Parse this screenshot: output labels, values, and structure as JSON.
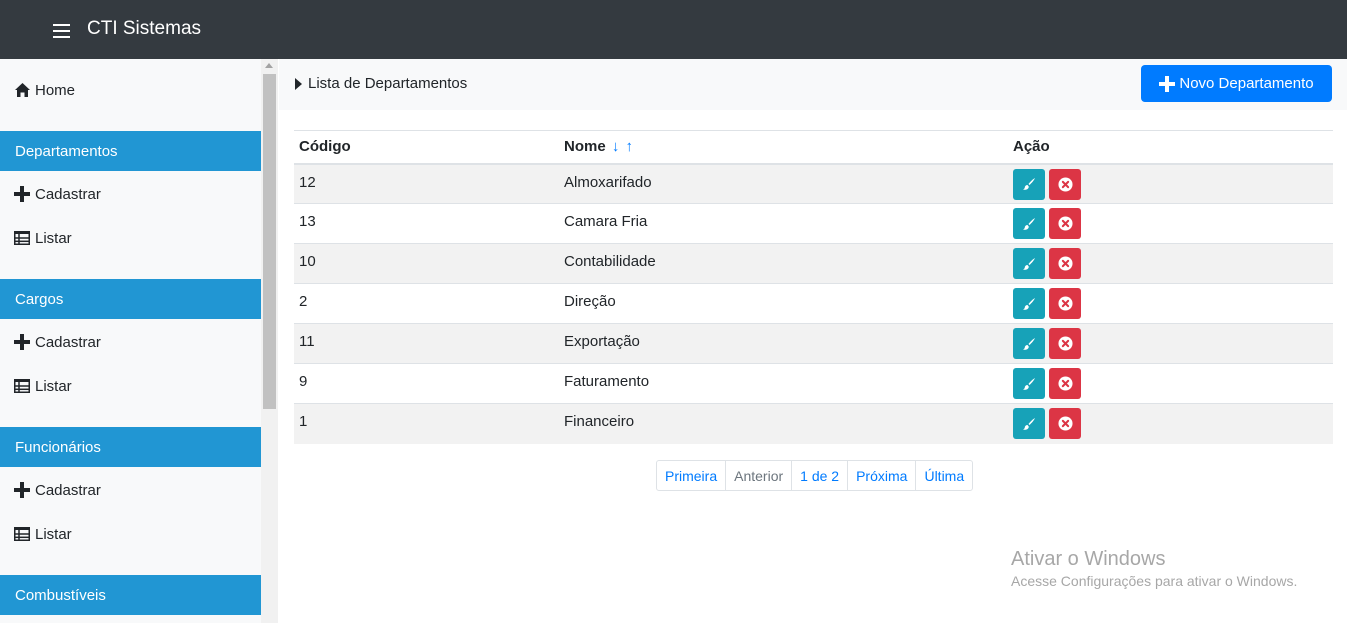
{
  "navbar": {
    "brand": "CTI Sistemas"
  },
  "sidebar": {
    "home": "Home",
    "sections": [
      {
        "title": "Departamentos",
        "add": "Cadastrar",
        "list": "Listar"
      },
      {
        "title": "Cargos",
        "add": "Cadastrar",
        "list": "Listar"
      },
      {
        "title": "Funcionários",
        "add": "Cadastrar",
        "list": "Listar"
      },
      {
        "title": "Combustíveis"
      }
    ]
  },
  "main": {
    "breadcrumb": "Lista de Departamentos",
    "new_button": "Novo Departamento",
    "table": {
      "headers": {
        "code": "Código",
        "name": "Nome",
        "action": "Ação"
      },
      "sort_down": "↓",
      "sort_up": "↑",
      "rows": [
        {
          "code": "12",
          "name": "Almoxarifado"
        },
        {
          "code": "13",
          "name": "Camara Fria"
        },
        {
          "code": "10",
          "name": "Contabilidade"
        },
        {
          "code": "2",
          "name": "Direção"
        },
        {
          "code": "11",
          "name": "Exportação"
        },
        {
          "code": "9",
          "name": "Faturamento"
        },
        {
          "code": "1",
          "name": "Financeiro"
        }
      ]
    },
    "pagination": {
      "first": "Primeira",
      "prev": "Anterior",
      "current": "1 de 2",
      "next": "Próxima",
      "last": "Última"
    }
  },
  "watermark": {
    "title": "Ativar o Windows",
    "subtitle": "Acesse Configurações para ativar o Windows."
  },
  "colors": {
    "navbar": "#343a40",
    "sidebar_header": "#2196d3",
    "primary": "#007bff",
    "edit": "#17a2b8",
    "delete": "#dc3545"
  },
  "icons": {
    "menu": "hamburger-icon",
    "home": "home-icon",
    "add": "plus-icon",
    "list": "table-list-icon",
    "breadcrumb": "caret-right-icon",
    "edit": "paintbrush-icon",
    "delete": "times-circle-icon"
  }
}
